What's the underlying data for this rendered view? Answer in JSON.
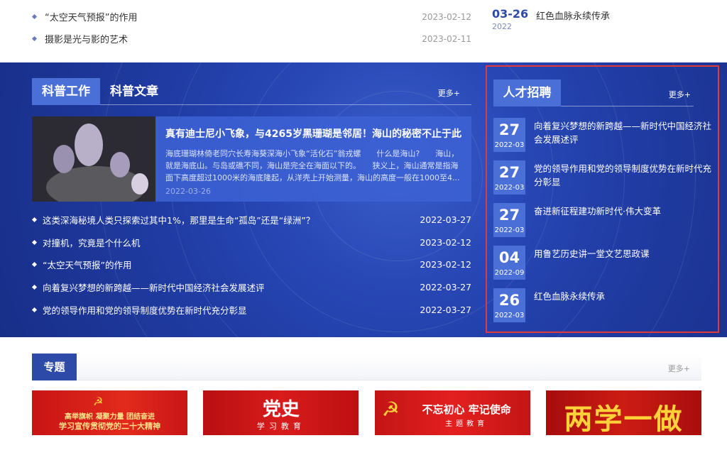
{
  "top": {
    "list": [
      {
        "title": "“太空天气预报”的作用",
        "date": "2023-02-12"
      },
      {
        "title": "摄影是光与影的艺术",
        "date": "2023-02-11"
      }
    ],
    "right": {
      "day": "03-26",
      "year": "2022",
      "title": "红色血脉永续传承"
    }
  },
  "science": {
    "tabs": [
      "科普工作",
      "科普文章"
    ],
    "more": "更多+",
    "feature": {
      "title": "真有迪士尼小飞象，与4265岁黑珊瑚是邻居！海山的秘密不止于此",
      "desc": "海底珊瑚林倚老同穴长寿海葵深海小飞象“活化石”翁戎螺　　什么是海山?　　海山，就是海底山。与岛或礁不同，海山是完全在海面以下的。　　狭义上，海山通常是指海面下高度超过1000米的海底隆起，从洋壳上开始测量，海山的高度一般在1000至4...",
      "date": "2022-03-26"
    },
    "list": [
      {
        "title": "这类深海秘境人类只探索过其中1%，那里是生命“孤岛”还是“绿洲”？",
        "date": "2022-03-27"
      },
      {
        "title": "对撞机，究竟是个什么机",
        "date": "2023-02-12"
      },
      {
        "title": "“太空天气预报”的作用",
        "date": "2023-02-12"
      },
      {
        "title": "向着复兴梦想的新跨越——新时代中国经济社会发展述评",
        "date": "2022-03-27"
      },
      {
        "title": "党的领导作用和党的领导制度优势在新时代充分彰显",
        "date": "2022-03-27"
      }
    ]
  },
  "jobs": {
    "title": "人才招聘",
    "more": "更多+",
    "items": [
      {
        "day": "27",
        "month": "2022-03",
        "title": "向着复兴梦想的新跨越——新时代中国经济社会发展述评"
      },
      {
        "day": "27",
        "month": "2022-03",
        "title": "党的领导作用和党的领导制度优势在新时代充分彰显"
      },
      {
        "day": "27",
        "month": "2022-03",
        "title": "奋进新征程建功新时代·伟大变革"
      },
      {
        "day": "04",
        "month": "2022-09",
        "title": "用鲁艺历史讲一堂文艺思政课"
      },
      {
        "day": "26",
        "month": "2022-03",
        "title": "红色血脉永续传承"
      }
    ]
  },
  "topics": {
    "title": "专题",
    "more": "更多+",
    "banners": [
      {
        "line1": "高举旗帜 凝聚力量 团结奋进",
        "line2": "学习宣传贯彻党的二十大精神"
      },
      {
        "line1": "党史",
        "line2": "学习教育"
      },
      {
        "line1": "不忘初心 牢记使命",
        "line2": "主题教育"
      },
      {
        "line1": "两学一做"
      }
    ]
  }
}
